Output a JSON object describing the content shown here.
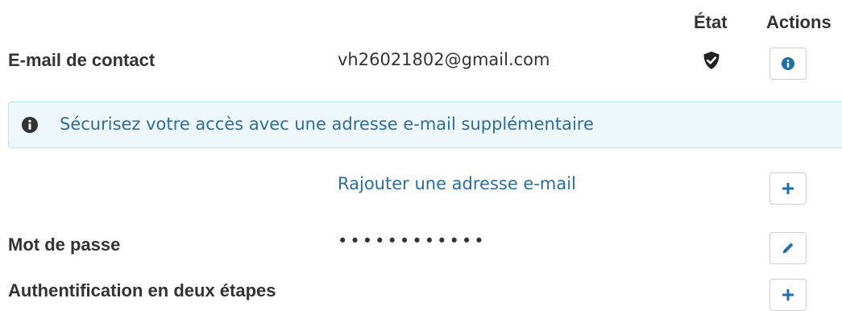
{
  "table_header": {
    "state": "État",
    "actions": "Actions"
  },
  "rows": {
    "contact_email": {
      "label": "E-mail de contact",
      "value": "vh26021802@gmail.com",
      "state_icon": "shield-check-icon",
      "action_icon": "info-icon"
    },
    "alert": {
      "icon": "info-icon",
      "text": "Sécurisez votre accès avec une adresse e-mail supplémentaire"
    },
    "add_email": {
      "link": "Rajouter une adresse e-mail",
      "action_icon": "plus-icon"
    },
    "password": {
      "label": "Mot de passe",
      "value": "••••••••••••",
      "action_icon": "pencil-icon"
    },
    "two_factor": {
      "label": "Authentification en deux étapes",
      "action_icon": "plus-icon"
    }
  },
  "colors": {
    "text": "#333333",
    "link": "#2a6da1",
    "icon_blue": "#1f6fa8",
    "alert_bg": "#eef7fc",
    "alert_border": "#bfe2f1",
    "alert_text": "#2f6d97",
    "state_icon": "#222222"
  }
}
